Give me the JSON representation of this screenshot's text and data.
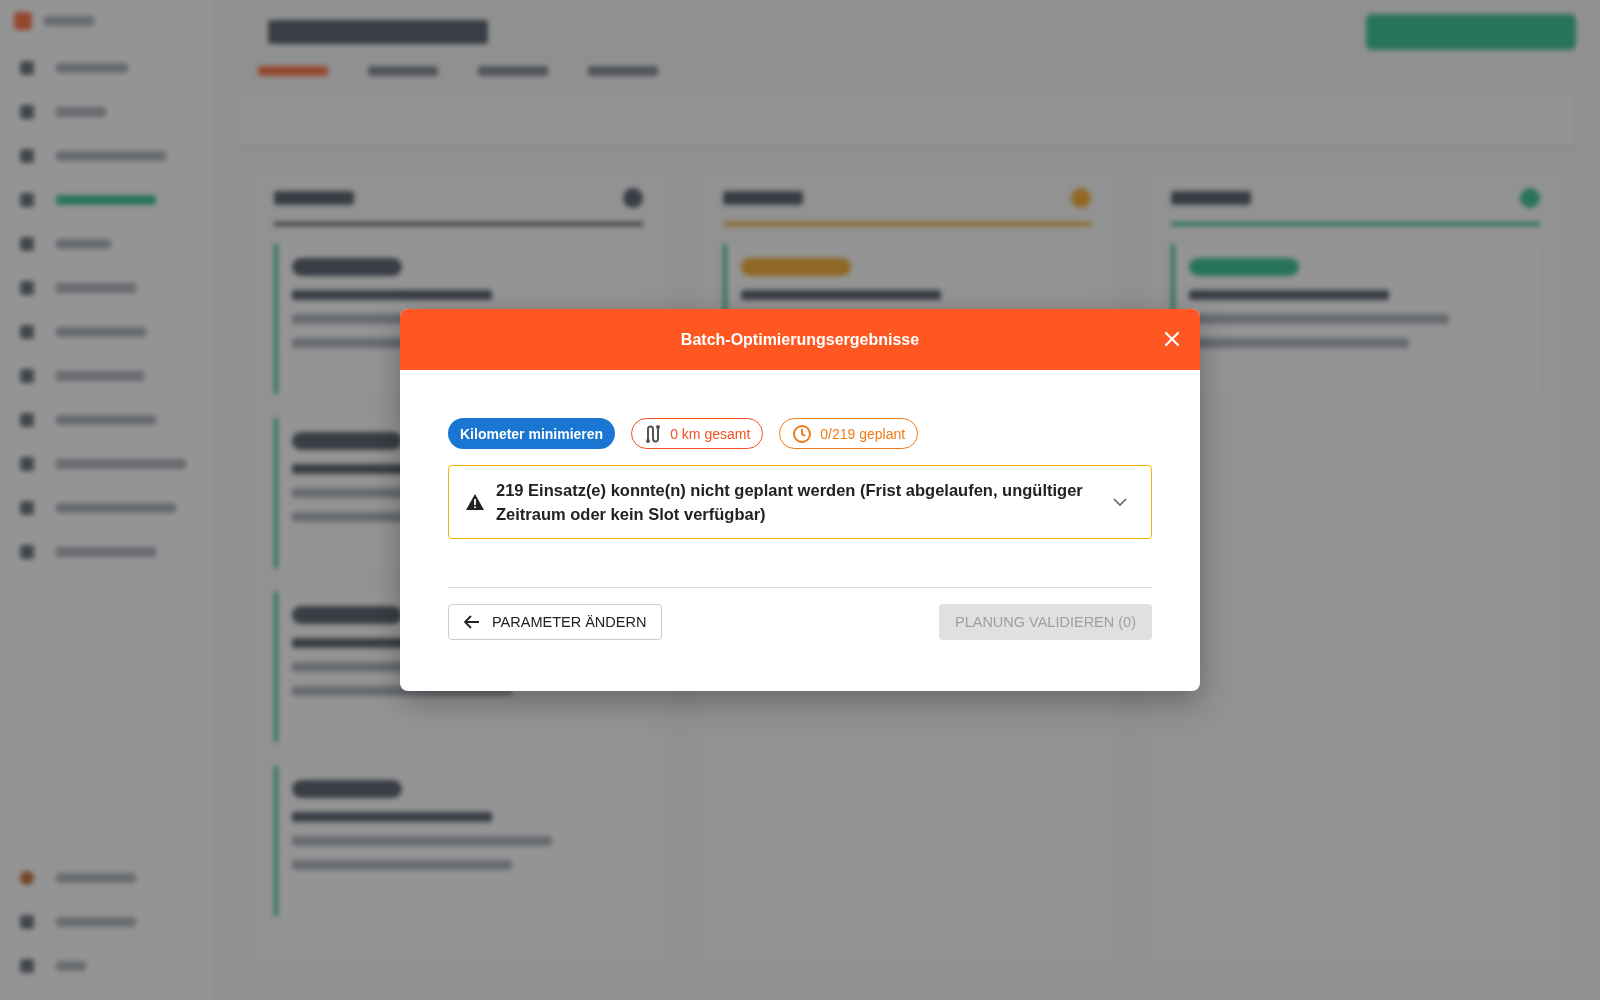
{
  "dialog": {
    "title": "Batch-Optimierungsergebnisse",
    "chips": [
      {
        "kind": "mode",
        "label": "Kilometer minimieren"
      },
      {
        "kind": "distance",
        "label": "0 km gesamt"
      },
      {
        "kind": "planned",
        "label": "0/219 geplant"
      }
    ],
    "warning": {
      "text": "219 Einsatz(e) konnte(n) nicht geplant werden (Frist abgelaufen, ungültiger Zeitraum oder kein Slot verfügbar)",
      "expanded": false
    },
    "back_button": "PARAMETER ÄNDERN",
    "validate_button": {
      "label": "PLANUNG VALIDIEREN (0)",
      "disabled": true
    }
  }
}
